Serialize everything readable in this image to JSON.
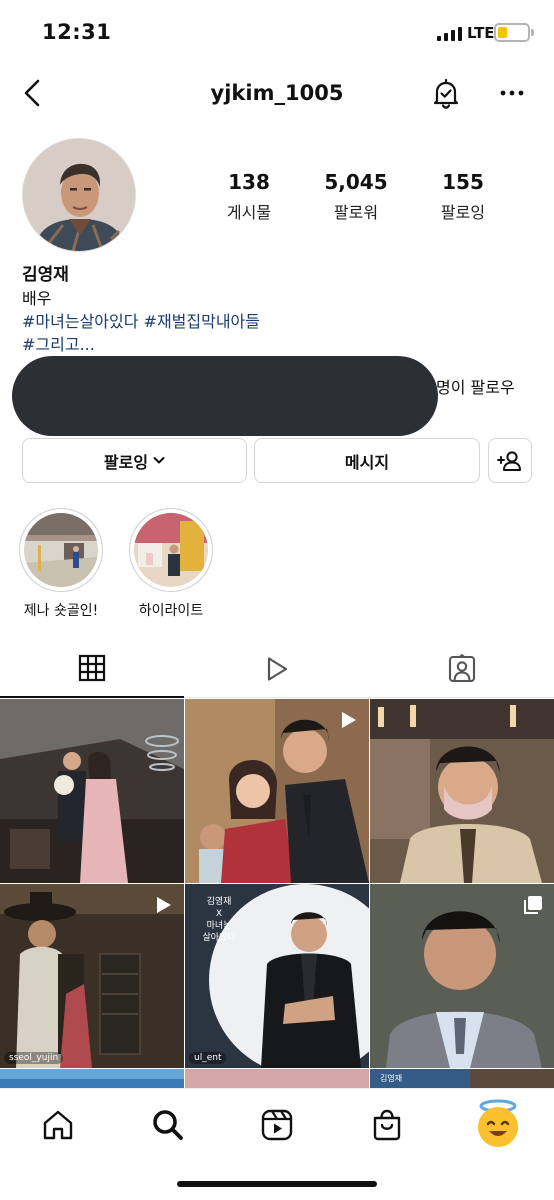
{
  "status_bar": {
    "time": "12:31",
    "network": "LTE",
    "battery_level": 0.25
  },
  "header": {
    "username": "yjkim_1005",
    "back_icon": "chevron-left-icon",
    "notify_icon": "bell-check-icon",
    "more_icon": "more-horizontal-icon"
  },
  "profile": {
    "stats": [
      {
        "value": "138",
        "label": "게시물"
      },
      {
        "value": "5,045",
        "label": "팔로워"
      },
      {
        "value": "155",
        "label": "팔로잉"
      }
    ],
    "name": "김영재",
    "category": "배우",
    "bio_tags_line1": "#마녀는살아있다 #재벌집막내아들",
    "bio_tags_line2": "#그리고...",
    "followed_by_suffix": "명이 팔로우"
  },
  "actions": {
    "following_label": "팔로잉",
    "message_label": "메시지",
    "add_user_icon": "add-person-icon"
  },
  "highlights": [
    {
      "label": "제나 숏골인!"
    },
    {
      "label": "하이라이트"
    }
  ],
  "tabs": [
    {
      "name": "grid",
      "icon": "grid-icon",
      "active": true
    },
    {
      "name": "reels",
      "icon": "play-icon",
      "active": false
    },
    {
      "name": "tagged",
      "icon": "tagged-person-icon",
      "active": false
    }
  ],
  "grid": {
    "captions": {
      "post5_line1": "김영재",
      "post5_line2": "X",
      "post5_line3": "마녀는",
      "post5_line4": "살아있다",
      "post9_text": "김영재"
    },
    "credits": {
      "post4": "sseol_yujin",
      "post5": "ul_ent"
    }
  },
  "bottom_nav": [
    {
      "name": "home",
      "icon": "home-icon"
    },
    {
      "name": "search",
      "icon": "search-icon"
    },
    {
      "name": "reels",
      "icon": "reels-icon"
    },
    {
      "name": "shop",
      "icon": "shop-bag-icon"
    },
    {
      "name": "profile",
      "icon": "angel-smile-avatar-icon"
    }
  ],
  "colors": {
    "hashtag": "#1c3b6e",
    "redaction": "#2c2f33",
    "battery": "#f5c400"
  }
}
